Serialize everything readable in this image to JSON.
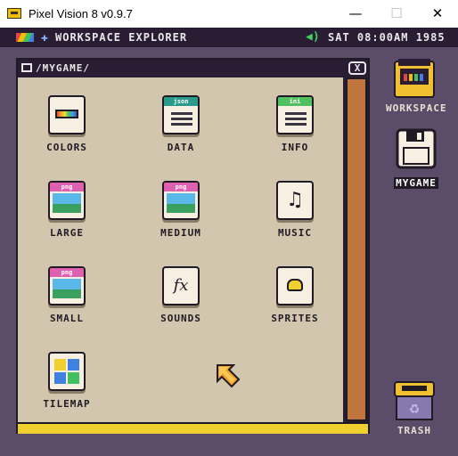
{
  "window": {
    "title": "Pixel Vision 8 v0.9.7",
    "controls": {
      "minimize": "—",
      "maximize": "☐",
      "close": "✕"
    }
  },
  "topbar": {
    "title": "WORKSPACE EXPLORER",
    "clock": "SAT 08:00AM 1985"
  },
  "explorer": {
    "path": "/MYGAME/",
    "close_label": "X",
    "files": [
      {
        "label": "COLORS",
        "icon": "colors-icon"
      },
      {
        "label": "DATA",
        "icon": "json-file-icon",
        "tag": "json"
      },
      {
        "label": "INFO",
        "icon": "ini-file-icon",
        "tag": "ini"
      },
      {
        "label": "LARGE",
        "icon": "png-file-icon",
        "tag": "png"
      },
      {
        "label": "MEDIUM",
        "icon": "png-file-icon",
        "tag": "png"
      },
      {
        "label": "MUSIC",
        "icon": "music-note-icon",
        "glyph": "♫"
      },
      {
        "label": "SMALL",
        "icon": "png-file-icon",
        "tag": "png"
      },
      {
        "label": "SOUNDS",
        "icon": "sound-fx-icon",
        "glyph": "fx"
      },
      {
        "label": "SPRITES",
        "icon": "sprite-icon"
      },
      {
        "label": "TILEMAP",
        "icon": "tilemap-icon"
      }
    ]
  },
  "desktop": {
    "items": [
      {
        "label": "WORKSPACE",
        "icon": "cartridge-icon"
      },
      {
        "label": "MYGAME",
        "icon": "disk-icon"
      },
      {
        "label": "TRASH",
        "icon": "trash-icon"
      }
    ]
  },
  "colors": {
    "background": "#5b4c6a",
    "bar": "#2a1d33",
    "window": "#d2c6ae",
    "scrollbar": "#c0743e",
    "footer": "#f0d030"
  }
}
